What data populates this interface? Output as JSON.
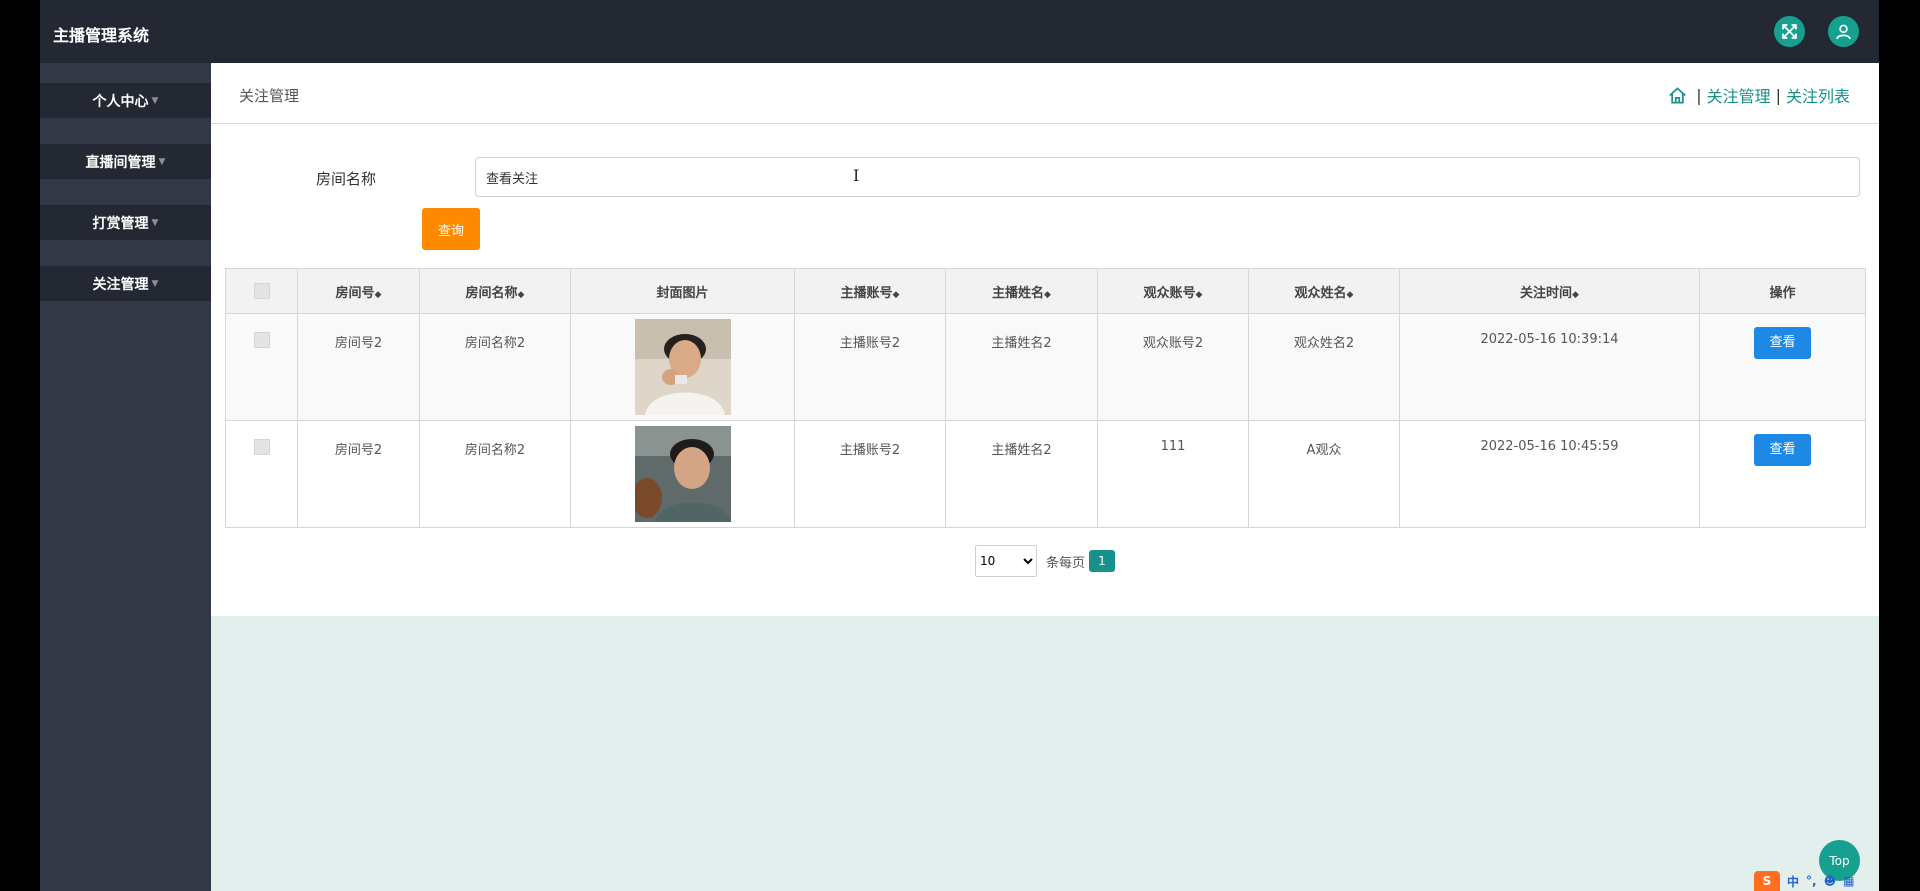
{
  "header": {
    "app_title": "主播管理系统"
  },
  "sidebar": {
    "items": [
      {
        "label": "个人中心"
      },
      {
        "label": "直播间管理"
      },
      {
        "label": "打赏管理"
      },
      {
        "label": "关注管理"
      }
    ]
  },
  "page": {
    "title": "关注管理",
    "breadcrumb": {
      "level1": "关注管理",
      "separator": "|",
      "level2": "关注列表"
    }
  },
  "search": {
    "label": "房间名称",
    "value": "查看关注",
    "button_label": "查询"
  },
  "table": {
    "columns": [
      "房间号",
      "房间名称",
      "封面图片",
      "主播账号",
      "主播姓名",
      "观众账号",
      "观众姓名",
      "关注时间",
      "操作"
    ],
    "rows": [
      {
        "room_no": "房间号2",
        "room_name": "房间名称2",
        "anchor_account": "主播账号2",
        "anchor_name": "主播姓名2",
        "viewer_account": "观众账号2",
        "viewer_name": "观众姓名2",
        "follow_time": "2022-05-16 10:39:14",
        "action": "查看"
      },
      {
        "room_no": "房间号2",
        "room_name": "房间名称2",
        "anchor_account": "主播账号2",
        "anchor_name": "主播姓名2",
        "viewer_account": "111",
        "viewer_name": "A观众",
        "follow_time": "2022-05-16 10:45:59",
        "action": "查看"
      }
    ]
  },
  "pagination": {
    "page_size": "10",
    "page_size_options": [
      "10"
    ],
    "per_page_label": "条每页",
    "current_page": "1"
  },
  "floating": {
    "top_label": "Top"
  },
  "ime": {
    "logo": "S",
    "mode": "中"
  },
  "colors": {
    "topbar": "#232833",
    "sidebar": "#323845",
    "accent": "#17918a",
    "query_button": "#ff8a00",
    "view_button": "#1e88e5"
  }
}
